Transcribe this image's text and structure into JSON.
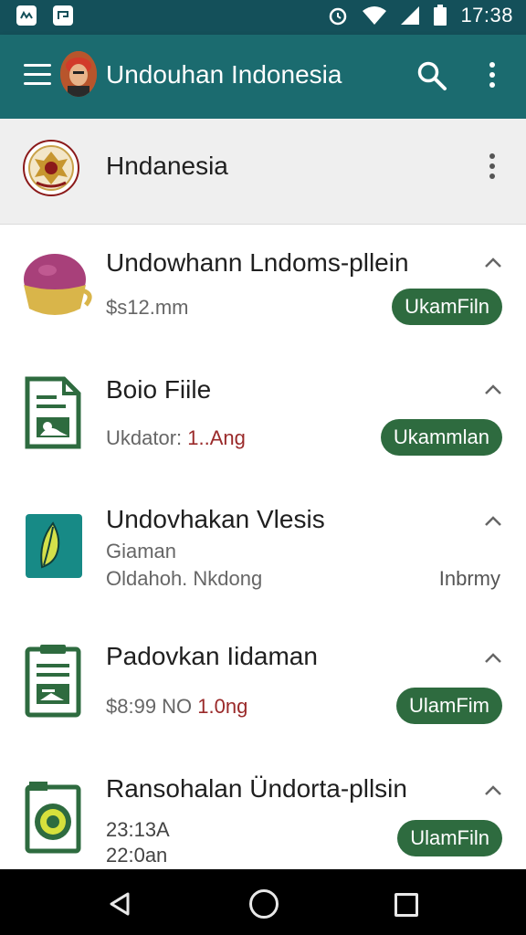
{
  "status_bar": {
    "time": "17:38",
    "icons": [
      "notification-icon",
      "notification-icon",
      "alarm-icon",
      "wifi-icon",
      "signal-icon",
      "battery-icon"
    ]
  },
  "app_bar": {
    "title": "Undouhan Indonesia",
    "icons": [
      "menu-icon",
      "search-icon",
      "more-vert-icon"
    ]
  },
  "header": {
    "title": "Hndanesia"
  },
  "items": [
    {
      "title": "Undowhann Lndoms-pllein",
      "subtitle": "$s12.mm",
      "subtitle_accent": "",
      "button": "UkamFiln",
      "icon": "bowl-icon"
    },
    {
      "title": "Boio Fiile",
      "subtitle": "Ukdator: ",
      "subtitle_accent": "1..Ang",
      "button": "Ukammlan",
      "icon": "document-icon"
    },
    {
      "title": "Undovhakan Vlesis",
      "subtitle": "Giaman",
      "subtitle2": "Oldahoh. Nkdong",
      "right_note": "Inbrmy",
      "icon": "leaf-icon"
    },
    {
      "title": "Padovkan Iidaman",
      "subtitle": "$8:99 NO ",
      "subtitle_accent": "1.0ng",
      "button": "UlamFim",
      "icon": "clipboard-icon"
    },
    {
      "title": "Ransohalan Ündorta-pllsin",
      "subtitle": "23:13A",
      "subtitle2": "22:0an",
      "button": "UlamFiln",
      "icon": "badge-icon"
    }
  ],
  "colors": {
    "status_bar": "#14505a",
    "app_bar": "#1b6b6f",
    "button": "#2e6b3f",
    "accent_text": "#9a2a2a"
  }
}
